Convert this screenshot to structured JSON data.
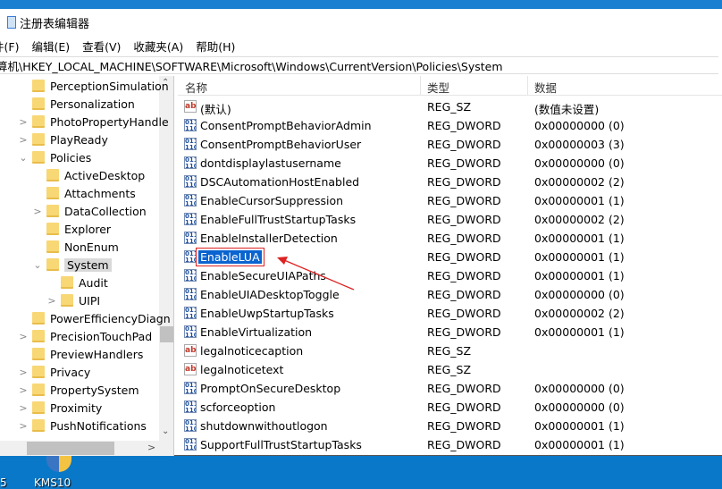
{
  "window": {
    "title": "注册表编辑器"
  },
  "menu": [
    "件(F)",
    "编辑(E)",
    "查看(V)",
    "收藏夹(A)",
    "帮助(H)"
  ],
  "address": "算机\\HKEY_LOCAL_MACHINE\\SOFTWARE\\Microsoft\\Windows\\CurrentVersion\\Policies\\System",
  "tree": [
    {
      "label": "PerceptionSimulation",
      "level": 0,
      "exp": ""
    },
    {
      "label": "Personalization",
      "level": 0,
      "exp": ""
    },
    {
      "label": "PhotoPropertyHandle",
      "level": 0,
      "exp": ">"
    },
    {
      "label": "PlayReady",
      "level": 0,
      "exp": ">"
    },
    {
      "label": "Policies",
      "level": 0,
      "exp": "v"
    },
    {
      "label": "ActiveDesktop",
      "level": 1,
      "exp": ""
    },
    {
      "label": "Attachments",
      "level": 1,
      "exp": ""
    },
    {
      "label": "DataCollection",
      "level": 1,
      "exp": ">"
    },
    {
      "label": "Explorer",
      "level": 1,
      "exp": ""
    },
    {
      "label": "NonEnum",
      "level": 1,
      "exp": ""
    },
    {
      "label": "System",
      "level": 1,
      "exp": "v",
      "selected": true
    },
    {
      "label": "Audit",
      "level": 2,
      "exp": ""
    },
    {
      "label": "UIPI",
      "level": 2,
      "exp": ">"
    },
    {
      "label": "PowerEfficiencyDiagn",
      "level": 0,
      "exp": ""
    },
    {
      "label": "PrecisionTouchPad",
      "level": 0,
      "exp": ">"
    },
    {
      "label": "PreviewHandlers",
      "level": 0,
      "exp": ""
    },
    {
      "label": "Privacy",
      "level": 0,
      "exp": ">"
    },
    {
      "label": "PropertySystem",
      "level": 0,
      "exp": ">"
    },
    {
      "label": "Proximity",
      "level": 0,
      "exp": ">"
    },
    {
      "label": "PushNotifications",
      "level": 0,
      "exp": ">"
    }
  ],
  "columns": {
    "name": "名称",
    "type": "类型",
    "data": "数据"
  },
  "values": [
    {
      "name": "(默认)",
      "type": "REG_SZ",
      "data": "(数值未设置)",
      "icon": "ab"
    },
    {
      "name": "ConsentPromptBehaviorAdmin",
      "type": "REG_DWORD",
      "data": "0x00000000 (0)",
      "icon": "dword"
    },
    {
      "name": "ConsentPromptBehaviorUser",
      "type": "REG_DWORD",
      "data": "0x00000003 (3)",
      "icon": "dword"
    },
    {
      "name": "dontdisplaylastusername",
      "type": "REG_DWORD",
      "data": "0x00000000 (0)",
      "icon": "dword"
    },
    {
      "name": "DSCAutomationHostEnabled",
      "type": "REG_DWORD",
      "data": "0x00000002 (2)",
      "icon": "dword"
    },
    {
      "name": "EnableCursorSuppression",
      "type": "REG_DWORD",
      "data": "0x00000001 (1)",
      "icon": "dword"
    },
    {
      "name": "EnableFullTrustStartupTasks",
      "type": "REG_DWORD",
      "data": "0x00000002 (2)",
      "icon": "dword"
    },
    {
      "name": "EnableInstallerDetection",
      "type": "REG_DWORD",
      "data": "0x00000001 (1)",
      "icon": "dword"
    },
    {
      "name": "EnableLUA",
      "type": "REG_DWORD",
      "data": "0x00000001 (1)",
      "icon": "dword",
      "selected": true
    },
    {
      "name": "EnableSecureUIAPaths",
      "type": "REG_DWORD",
      "data": "0x00000001 (1)",
      "icon": "dword"
    },
    {
      "name": "EnableUIADesktopToggle",
      "type": "REG_DWORD",
      "data": "0x00000000 (0)",
      "icon": "dword"
    },
    {
      "name": "EnableUwpStartupTasks",
      "type": "REG_DWORD",
      "data": "0x00000002 (2)",
      "icon": "dword"
    },
    {
      "name": "EnableVirtualization",
      "type": "REG_DWORD",
      "data": "0x00000001 (1)",
      "icon": "dword"
    },
    {
      "name": "legalnoticecaption",
      "type": "REG_SZ",
      "data": "",
      "icon": "ab"
    },
    {
      "name": "legalnoticetext",
      "type": "REG_SZ",
      "data": "",
      "icon": "ab"
    },
    {
      "name": "PromptOnSecureDesktop",
      "type": "REG_DWORD",
      "data": "0x00000000 (0)",
      "icon": "dword"
    },
    {
      "name": "scforceoption",
      "type": "REG_DWORD",
      "data": "0x00000000 (0)",
      "icon": "dword"
    },
    {
      "name": "shutdownwithoutlogon",
      "type": "REG_DWORD",
      "data": "0x00000001 (1)",
      "icon": "dword"
    },
    {
      "name": "SupportFullTrustStartupTasks",
      "type": "REG_DWORD",
      "data": "0x00000001 (1)",
      "icon": "dword"
    }
  ],
  "desktop": {
    "icon_label": "KMS10",
    "left_label": "5"
  }
}
